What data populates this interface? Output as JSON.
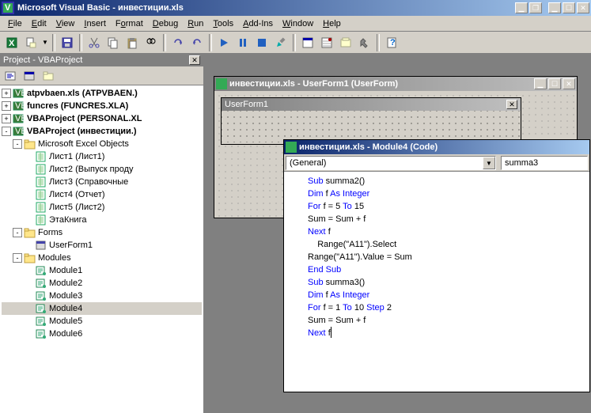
{
  "app": {
    "title": "Microsoft Visual Basic - инвестиции.xls",
    "icon_char": "✦"
  },
  "menu": [
    {
      "label": "File",
      "u": "F"
    },
    {
      "label": "Edit",
      "u": "E"
    },
    {
      "label": "View",
      "u": "V"
    },
    {
      "label": "Insert",
      "u": "I"
    },
    {
      "label": "Format",
      "u": "o"
    },
    {
      "label": "Debug",
      "u": "D"
    },
    {
      "label": "Run",
      "u": "R"
    },
    {
      "label": "Tools",
      "u": "T"
    },
    {
      "label": "Add-Ins",
      "u": "A"
    },
    {
      "label": "Window",
      "u": "W"
    },
    {
      "label": "Help",
      "u": "H"
    }
  ],
  "project_panel": {
    "title": "Project - VBAProject"
  },
  "tree": {
    "roots": [
      {
        "exp": "+",
        "label": "atpvbaen.xls (ATPVBAEN.)",
        "bold": true,
        "icon": "vba"
      },
      {
        "exp": "+",
        "label": "funcres (FUNCRES.XLA)",
        "bold": true,
        "icon": "vba"
      },
      {
        "exp": "+",
        "label": "VBAProject (PERSONAL.XL",
        "bold": true,
        "icon": "vba"
      },
      {
        "exp": "-",
        "label": "VBAProject (инвестиции.)",
        "bold": true,
        "icon": "vba"
      }
    ],
    "excel_objects": {
      "exp": "-",
      "label": "Microsoft Excel Objects",
      "icon": "folder"
    },
    "sheets": [
      {
        "label": "Лист1 (Лист1)"
      },
      {
        "label": "Лист2 (Выпуск проду"
      },
      {
        "label": "Лист3 (Справочные "
      },
      {
        "label": "Лист4 (Отчет)"
      },
      {
        "label": "Лист5 (Лист2)"
      },
      {
        "label": "ЭтаКнига"
      }
    ],
    "forms": {
      "exp": "-",
      "label": "Forms",
      "icon": "folder"
    },
    "forms_items": [
      {
        "label": "UserForm1"
      }
    ],
    "modules": {
      "exp": "-",
      "label": "Modules",
      "icon": "folder"
    },
    "modules_items": [
      {
        "label": "Module1"
      },
      {
        "label": "Module2"
      },
      {
        "label": "Module3"
      },
      {
        "label": "Module4",
        "sel": true
      },
      {
        "label": "Module5"
      },
      {
        "label": "Module6"
      }
    ]
  },
  "userform_win": {
    "title": "инвестиции.xls - UserForm1 (UserForm)",
    "form_caption": "UserForm1"
  },
  "code_win": {
    "title": "инвестиции.xls - Module4 (Code)",
    "combo_left": "(General)",
    "combo_right": "summa3",
    "lines": [
      [
        {
          "t": "Sub ",
          "kw": true
        },
        {
          "t": "summa2()"
        }
      ],
      [
        {
          "t": "Dim ",
          "kw": true
        },
        {
          "t": "f "
        },
        {
          "t": "As Integer",
          "kw": true
        }
      ],
      [
        {
          "t": "For ",
          "kw": true
        },
        {
          "t": "f = 5 "
        },
        {
          "t": "To ",
          "kw": true
        },
        {
          "t": "15"
        }
      ],
      [
        {
          "t": "Sum = Sum + f"
        }
      ],
      [
        {
          "t": "Next ",
          "kw": true
        },
        {
          "t": "f"
        }
      ],
      [
        {
          "t": "    Range(\"A11\").Select"
        }
      ],
      [
        {
          "t": "Range(\"A11\").Value = Sum"
        }
      ],
      [
        {
          "t": "End Sub",
          "kw": true
        }
      ],
      [
        {
          "t": "Sub ",
          "kw": true
        },
        {
          "t": "summa3()"
        }
      ],
      [
        {
          "t": "Dim ",
          "kw": true
        },
        {
          "t": "f "
        },
        {
          "t": "As Integer",
          "kw": true
        }
      ],
      [
        {
          "t": "For ",
          "kw": true
        },
        {
          "t": "f = 1 "
        },
        {
          "t": "To ",
          "kw": true
        },
        {
          "t": "10 "
        },
        {
          "t": "Step ",
          "kw": true
        },
        {
          "t": "2"
        }
      ],
      [
        {
          "t": "Sum = Sum + f"
        }
      ],
      [
        {
          "t": "Next ",
          "kw": true
        },
        {
          "t": "f",
          "cursor": true
        }
      ]
    ]
  }
}
